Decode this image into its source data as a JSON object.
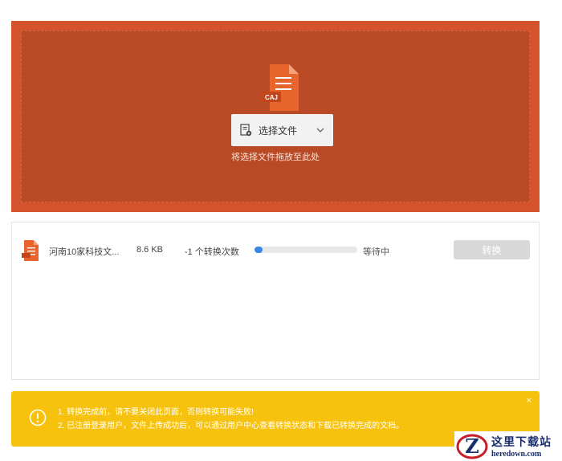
{
  "dropzone": {
    "file_icon_label": "CAJ",
    "select_button_label": "选择文件",
    "hint": "将选择文件拖放至此处"
  },
  "file_list": {
    "items": [
      {
        "name": "河南10家科技文...",
        "size": "8.6 KB",
        "count": "-1 个转换次数",
        "progress_percent": 8,
        "status": "等待中",
        "convert_label": "转换"
      }
    ]
  },
  "notice": {
    "line1": "1. 转换完成前，请不要关闭此页面，否则转换可能失败!",
    "line2": "2. 已注册登录用户，文件上传成功后，可以通过用户中心查看转换状态和下载已转换完成的文档。",
    "close": "×"
  },
  "watermark": {
    "cn": "这里下载站",
    "en": "heredown.com"
  },
  "colors": {
    "brand_orange": "#d4532c",
    "brand_orange_dark": "#b94a25",
    "progress_blue": "#3a86e8",
    "notice_yellow": "#f7c20e"
  }
}
